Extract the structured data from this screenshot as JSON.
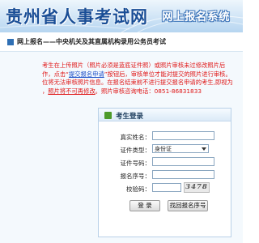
{
  "banner": {
    "title": "贵州省人事考试网",
    "subtitle": "网上报名系统"
  },
  "nav": {
    "text": "网上报名——中央机关及其直属机构录用公务员考试"
  },
  "notice": {
    "line1": "考生在上传照片（照片必须是蓝底证件照）或照片审核未过修改照片后",
    "line2_pre": "作，点击“",
    "line2_link": "提交报名申请",
    "line2_post": "”按钮后，审核单位才能对提交的照片进行审核。",
    "line3": "位将无法审核照片信息。在报名结束前不进行提交报名申请的考生,即视为",
    "line4_pre": "，",
    "line4_link": "照片将不可再修改",
    "line4_post": "。照片审核咨询电话：0851-86831833"
  },
  "login": {
    "title": "考生登录",
    "name_label": "真实姓名：",
    "idtype_label": "证件类型：",
    "idtype_value": "身份证",
    "idnum_label": "证件号码：",
    "regnum_label": "报名序号：",
    "captcha_label": "校验码：",
    "captcha_text": "3478",
    "login_button": "登 录",
    "find_button": "找回报名序号"
  },
  "colors": {
    "title": "#1a4e96",
    "notice": "#e01818",
    "link": "#1a4ec8",
    "panel_bg": "#f4f9fd"
  }
}
